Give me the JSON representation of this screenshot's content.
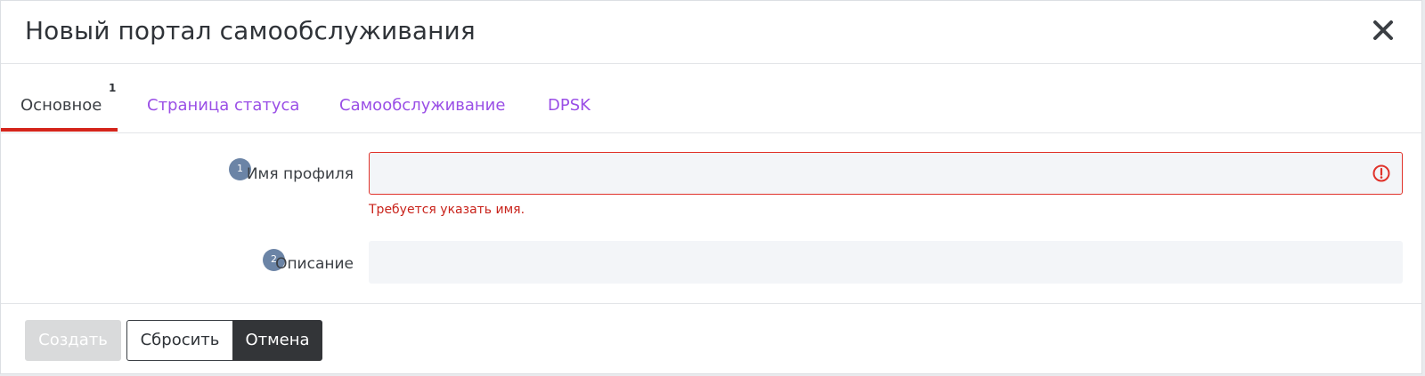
{
  "dialog": {
    "title": "Новый портал самообслуживания",
    "close_icon": "close-icon"
  },
  "tabs": [
    {
      "label": "Основное",
      "badge": "1",
      "active": true
    },
    {
      "label": "Страница статуса"
    },
    {
      "label": "Самообслуживание"
    },
    {
      "label": "DPSK"
    }
  ],
  "form": {
    "profile_name": {
      "step": "1",
      "label": "Имя профиля",
      "value": "",
      "error": "Требуется указать имя.",
      "error_icon": "alert-circle-icon"
    },
    "description": {
      "step": "2",
      "label": "Описание",
      "value": ""
    }
  },
  "footer": {
    "create_label": "Создать",
    "reset_label": "Сбросить",
    "cancel_label": "Отмена"
  },
  "colors": {
    "accent": "#9a4fe6",
    "active_underline": "#d4241b",
    "error": "#e0322a",
    "step_badge": "#6b84a6",
    "cancel_bg": "#333538",
    "disabled": "#d9dadb"
  }
}
